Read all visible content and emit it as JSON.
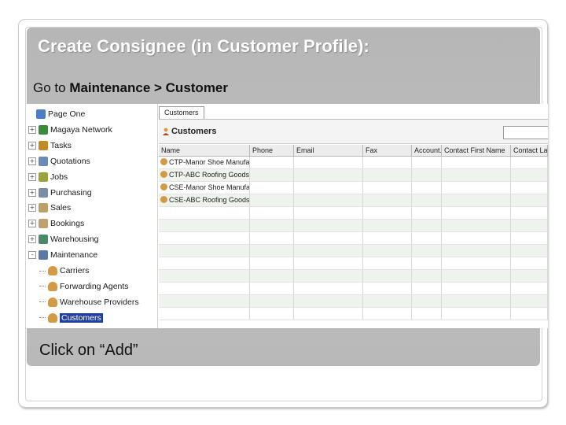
{
  "slide": {
    "title": "Create Consignee (in Customer Profile):",
    "subtitle_prefix": "Go to ",
    "subtitle_path": "Maintenance > Customer",
    "footer": "Click on “Add”"
  },
  "tree": {
    "items": [
      {
        "label": "Page One",
        "icon": "page-icon",
        "expander": ""
      },
      {
        "label": "Magaya Network",
        "icon": "network-icon",
        "expander": "+"
      },
      {
        "label": "Tasks",
        "icon": "tasks-icon",
        "expander": "+"
      },
      {
        "label": "Quotations",
        "icon": "quotations-icon",
        "expander": "+"
      },
      {
        "label": "Jobs",
        "icon": "jobs-icon",
        "expander": "+"
      },
      {
        "label": "Purchasing",
        "icon": "purchasing-icon",
        "expander": "+"
      },
      {
        "label": "Sales",
        "icon": "sales-icon",
        "expander": "+"
      },
      {
        "label": "Bookings",
        "icon": "bookings-icon",
        "expander": "+"
      },
      {
        "label": "Warehousing",
        "icon": "warehousing-icon",
        "expander": "+"
      },
      {
        "label": "Maintenance",
        "icon": "maintenance-icon",
        "expander": "-"
      },
      {
        "label": "Carriers",
        "icon": "person-icon",
        "expander": ""
      },
      {
        "label": "Forwarding Agents",
        "icon": "person-icon",
        "expander": ""
      },
      {
        "label": "Warehouse Providers",
        "icon": "person-icon",
        "expander": ""
      },
      {
        "label": "Customers",
        "icon": "person-icon",
        "expander": "",
        "selected": true
      }
    ]
  },
  "main": {
    "tab_label": "Customers",
    "header_title": "Customers",
    "columns": [
      "Name",
      "Phone",
      "Email",
      "Fax",
      "Account...",
      "Contact First Name",
      "Contact Last N"
    ],
    "rows": [
      [
        "CTP-Manor Shoe Manufacturing Inc",
        "",
        "",
        "",
        "",
        "",
        ""
      ],
      [
        "CTP-ABC Roofing Goods Inc.",
        "",
        "",
        "",
        "",
        "",
        ""
      ],
      [
        "CSE-Manor Shoe Manufacturing Inc",
        "",
        "",
        "",
        "",
        "",
        ""
      ],
      [
        "CSE-ABC Roofing Goods Inc.",
        "",
        "",
        "",
        "",
        "",
        ""
      ]
    ],
    "empty_rows": 9
  },
  "colors": {
    "panel_gray": "#b9b9b9",
    "selection": "#1f3f9a",
    "row_alt": "#eef4ec"
  }
}
